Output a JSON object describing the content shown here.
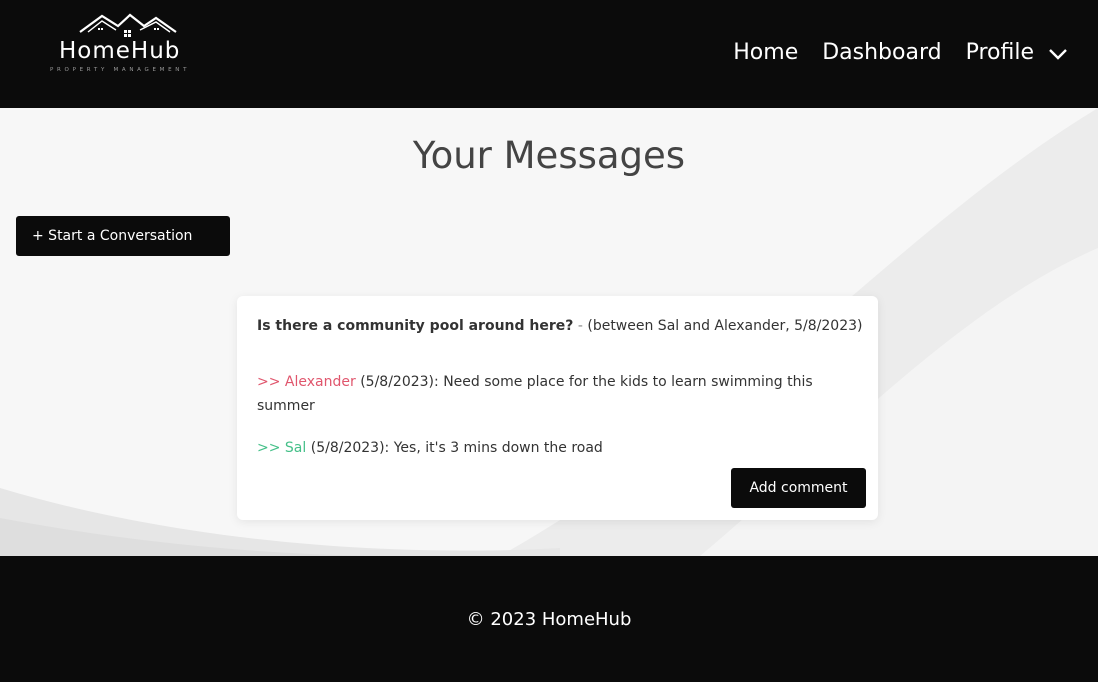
{
  "brand": {
    "name": "HomeHub",
    "tagline": "PROPERTY MANAGEMENT"
  },
  "nav": {
    "home": "Home",
    "dashboard": "Dashboard",
    "profile": "Profile"
  },
  "page": {
    "title": "Your Messages",
    "start_button": "+ Start a Conversation"
  },
  "thread": {
    "subject": "Is there a community pool around here?",
    "separator": " - ",
    "meta": "(between Sal and Alexander, 5/8/2023)",
    "messages": [
      {
        "arrows": ">>",
        "author": "Alexander",
        "date": "(5/8/2023):",
        "text": "Need some place for the kids to learn swimming this summer",
        "color": "#e0566d"
      },
      {
        "arrows": ">>",
        "author": "Sal",
        "date": "(5/8/2023):",
        "text": "Yes, it's 3 mins down the road",
        "color": "#45c089"
      }
    ],
    "add_comment_button": "Add comment"
  },
  "footer": {
    "copyright": "© 2023 HomeHub"
  }
}
